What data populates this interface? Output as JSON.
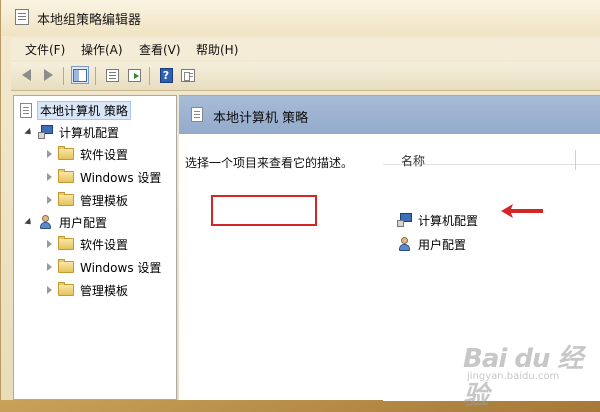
{
  "window": {
    "title": "本地组策略编辑器"
  },
  "menu": [
    {
      "id": "file",
      "label": "文件(F)"
    },
    {
      "id": "action",
      "label": "操作(A)"
    },
    {
      "id": "view",
      "label": "查看(V)"
    },
    {
      "id": "help",
      "label": "帮助(H)"
    }
  ],
  "toolbar": {
    "icons": [
      "back-arrow-icon",
      "forward-arrow-icon",
      "show-hide-tree-icon",
      "list-icon",
      "export-icon",
      "help-icon",
      "properties-icon"
    ]
  },
  "tree": {
    "root": "本地计算机 策略",
    "computer_config": "计算机配置",
    "user_config": "用户配置",
    "software_settings": "软件设置",
    "windows_settings": "Windows 设置",
    "admin_templates": "管理模板"
  },
  "detail": {
    "title": "本地计算机 策略",
    "description": "选择一个项目来查看它的描述。",
    "column_name": "名称",
    "items": [
      "计算机配置",
      "用户配置"
    ]
  },
  "annotation": {
    "color": "#d32626"
  },
  "watermark": {
    "logo": "Bai du 经验",
    "url": "jingyan.baidu.com"
  }
}
